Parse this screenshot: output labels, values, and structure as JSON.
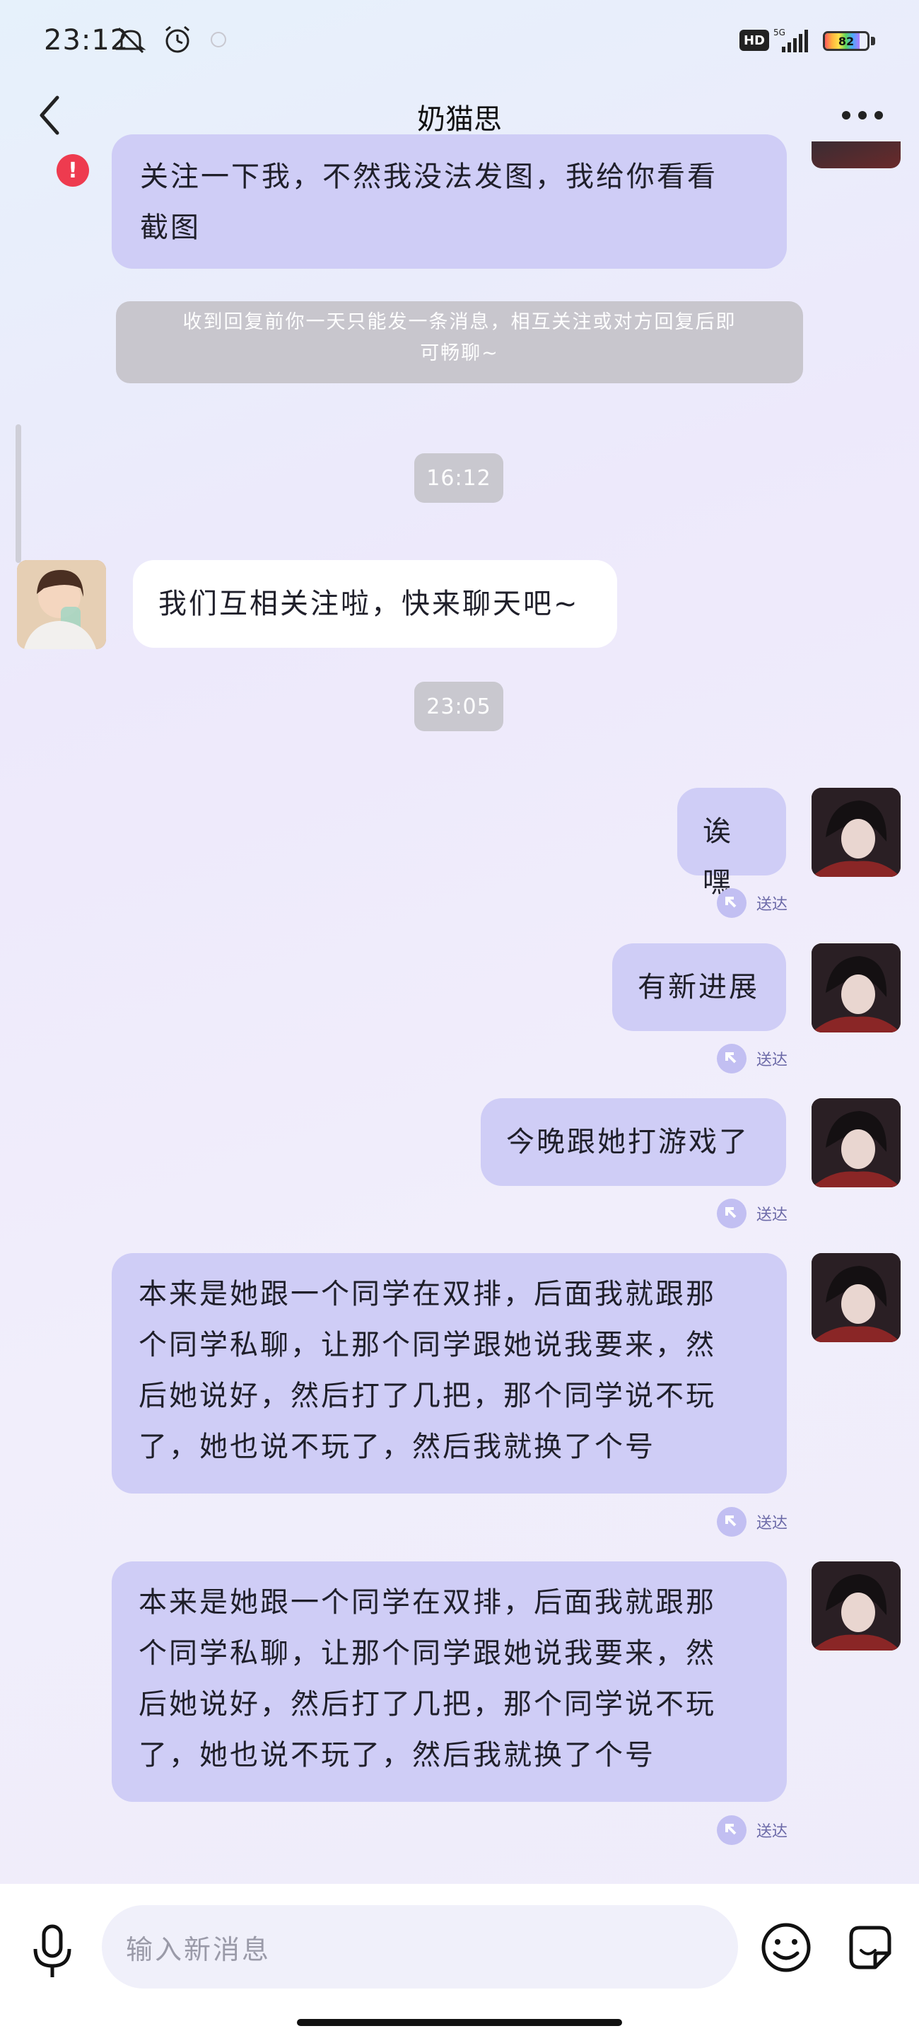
{
  "status_bar": {
    "time": "23:12",
    "hd": "HD",
    "network": "5G",
    "battery": "82",
    "icons": [
      "mute-icon",
      "alarm-icon",
      "extra-icon",
      "signal-icon",
      "battery-icon"
    ]
  },
  "header": {
    "title": "奶猫思",
    "back_icon": "chevron-left-icon",
    "more_icon": "more-dots-icon"
  },
  "conversation": {
    "partial_message": {
      "lines": [
        "关注一下我，不然我没法发图，我给你看看",
        "截图"
      ],
      "status": "error"
    },
    "notice": {
      "lines": [
        "收到回复前你一天只能发一条消息，相互关注或对方回复后即",
        "可畅聊~"
      ]
    },
    "time_1": "16:12",
    "incoming_message": "我们互相关注啦，快来聊天吧~",
    "time_2": "23:05",
    "outgoing_messages": [
      {
        "lines": [
          "诶嘿"
        ],
        "status": "送达"
      },
      {
        "lines": [
          "有新进展"
        ],
        "status": "送达"
      },
      {
        "lines": [
          "今晚跟她打游戏了"
        ],
        "status": "送达"
      },
      {
        "lines": [
          "本来是她跟一个同学在双排，后面我就跟那",
          "个同学私聊，让那个同学跟她说我要来，然",
          "后她说好，然后打了几把，那个同学说不玩",
          "了，她也说不玩了，然后我就换了个号"
        ],
        "status": "送达"
      },
      {
        "lines": [
          "本来是她跟一个同学在双排，后面我就跟那",
          "个同学私聊，让那个同学跟她说我要来，然",
          "后她说好，然后打了几把，那个同学说不玩",
          "了，她也说不玩了，然后我就换了个号"
        ],
        "status": "送达"
      }
    ]
  },
  "input_bar": {
    "placeholder": "输入新消息",
    "mic_icon": "microphone-icon",
    "emoji_icon": "emoji-icon",
    "sticker_icon": "sticker-icon"
  },
  "colors": {
    "outgoing_bubble": "#cfcdf6",
    "incoming_bubble": "#ffffff",
    "error": "#ee3b4f",
    "delivered_text": "#6c6aa8"
  }
}
